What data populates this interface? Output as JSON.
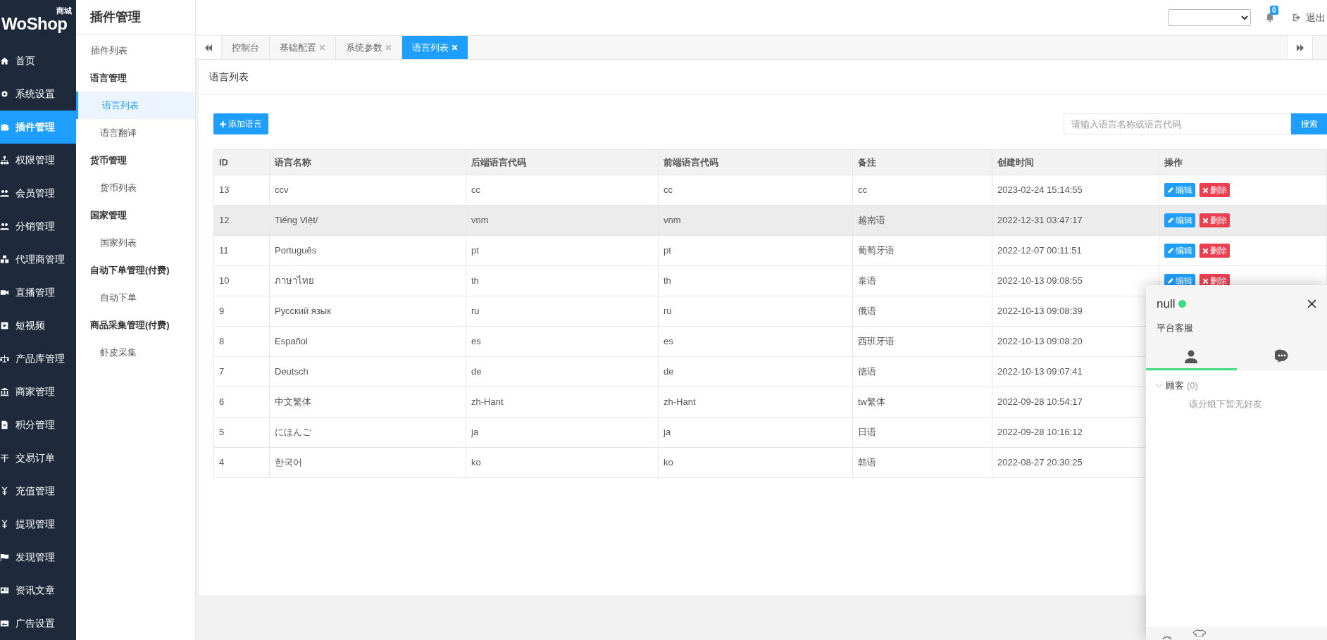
{
  "logo": {
    "text": "WoShop",
    "badge": "商城"
  },
  "sidebar": {
    "items": [
      {
        "label": "首页",
        "selected": false
      },
      {
        "label": "系统设置",
        "selected": false
      },
      {
        "label": "插件管理",
        "selected": true
      },
      {
        "label": "权限管理",
        "selected": false
      },
      {
        "label": "会员管理",
        "selected": false
      },
      {
        "label": "分销管理",
        "selected": false
      },
      {
        "label": "代理商管理",
        "selected": false
      },
      {
        "label": "直播管理",
        "selected": false
      },
      {
        "label": "短视频",
        "selected": false
      },
      {
        "label": "产品库管理",
        "selected": false
      },
      {
        "label": "商家管理",
        "selected": false
      },
      {
        "label": "积分管理",
        "selected": false
      },
      {
        "label": "交易订单",
        "selected": false
      },
      {
        "label": "充值管理",
        "selected": false
      },
      {
        "label": "提现管理",
        "selected": false
      },
      {
        "label": "发现管理",
        "selected": false
      },
      {
        "label": "资讯文章",
        "selected": false
      },
      {
        "label": "广告设置",
        "selected": false
      }
    ]
  },
  "subnav": {
    "title": "插件管理",
    "items": [
      {
        "kind": "link",
        "label": "插件列表",
        "selected": false
      },
      {
        "kind": "group",
        "label": "语言管理"
      },
      {
        "kind": "link",
        "label": "语言列表",
        "selected": true
      },
      {
        "kind": "link",
        "label": "语言翻译",
        "selected": false
      },
      {
        "kind": "group",
        "label": "货币管理"
      },
      {
        "kind": "link",
        "label": "货币列表",
        "selected": false
      },
      {
        "kind": "group",
        "label": "国家管理"
      },
      {
        "kind": "link",
        "label": "国家列表",
        "selected": false
      },
      {
        "kind": "group",
        "label": "自动下单管理(付费)"
      },
      {
        "kind": "link",
        "label": "自动下单",
        "selected": false
      },
      {
        "kind": "group",
        "label": "商品采集管理(付费)"
      },
      {
        "kind": "link",
        "label": "虾皮采集",
        "selected": false
      }
    ]
  },
  "topbar": {
    "notification_count": "0",
    "logout": "退出"
  },
  "tabs": [
    {
      "label": "控制台",
      "closable": false,
      "selected": false
    },
    {
      "label": "基础配置",
      "closable": true,
      "selected": false
    },
    {
      "label": "系统参数",
      "closable": true,
      "selected": false
    },
    {
      "label": "语言列表",
      "closable": true,
      "selected": true
    }
  ],
  "card": {
    "title": "语言列表",
    "add_button": "添加语言",
    "search": {
      "placeholder": "请输入语言名称或语言代码",
      "button": "搜索"
    }
  },
  "table": {
    "columns": [
      "ID",
      "语言名称",
      "后端语言代码",
      "前端语言代码",
      "备注",
      "创建时间",
      "操作"
    ],
    "rows": [
      {
        "cells": [
          "13",
          "ccv",
          "cc",
          "cc",
          "cc",
          "2023-02-24 15:14:55"
        ],
        "highlighted": false,
        "actions": [
          "编辑",
          "删除"
        ]
      },
      {
        "cells": [
          "12",
          "Tiếng Việt/",
          "vnm",
          "vnm",
          "越南语",
          "2022-12-31 03:47:17"
        ],
        "highlighted": true,
        "actions": [
          "编辑",
          "删除"
        ]
      },
      {
        "cells": [
          "11",
          "Português",
          "pt",
          "pt",
          "葡萄牙语",
          "2022-12-07 00:11:51"
        ],
        "highlighted": false,
        "actions": [
          "编辑",
          "删除"
        ]
      },
      {
        "cells": [
          "10",
          "ภาษาไทย",
          "th",
          "th",
          "泰语",
          "2022-10-13 09:08:55"
        ],
        "highlighted": false,
        "actions": [
          "编辑",
          "删除"
        ]
      },
      {
        "cells": [
          "9",
          "Русский язык",
          "ru",
          "ru",
          "俄语",
          "2022-10-13 09:08:39"
        ],
        "highlighted": false
      },
      {
        "cells": [
          "8",
          "Español",
          "es",
          "es",
          "西班牙语",
          "2022-10-13 09:08:20"
        ],
        "highlighted": false
      },
      {
        "cells": [
          "7",
          "Deutsch",
          "de",
          "de",
          "德语",
          "2022-10-13 09:07:41"
        ],
        "highlighted": false
      },
      {
        "cells": [
          "6",
          "中文繁体",
          "zh-Hant",
          "zh-Hant",
          "tw繁体",
          "2022-09-28 10:54:17"
        ],
        "highlighted": false
      },
      {
        "cells": [
          "5",
          "にほんご",
          "ja",
          "ja",
          "日语",
          "2022-09-28 10:16:12"
        ],
        "highlighted": false
      },
      {
        "cells": [
          "4",
          "한국어",
          "ko",
          "ko",
          "韩语",
          "2022-08-27 20:30:25"
        ],
        "highlighted": false
      }
    ]
  },
  "chat": {
    "name": "null",
    "online": true,
    "subtitle": "平台客服",
    "tabs": [
      {
        "kind": "contacts",
        "selected": true
      },
      {
        "kind": "messages",
        "selected": false
      }
    ],
    "group": {
      "label": "顾客",
      "count": "(0)",
      "expanded": true,
      "empty_text": "该分组下暂无好友"
    }
  }
}
